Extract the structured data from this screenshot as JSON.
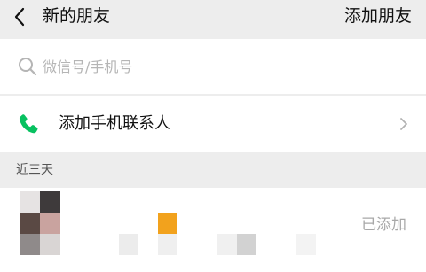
{
  "header": {
    "title": "新的朋友",
    "action_label": "添加朋友"
  },
  "search": {
    "placeholder": "微信号/手机号",
    "value": ""
  },
  "add_phone_contacts": {
    "label": "添加手机联系人",
    "icon": "phone-icon",
    "icon_color": "#07c160"
  },
  "sections": {
    "recent_label": "近三天"
  },
  "requests": [
    {
      "status": "已添加"
    }
  ],
  "colors": {
    "background": "#ededed",
    "surface": "#ffffff",
    "accent_green": "#07c160",
    "muted_text": "#a8a8a8"
  }
}
